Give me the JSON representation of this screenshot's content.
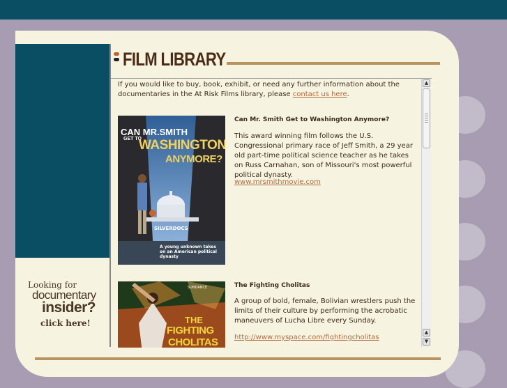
{
  "colors": {
    "brand_teal": "#0a4e63",
    "accent_brown": "#b89460",
    "link": "#b06b3a",
    "text": "#3b2a1b"
  },
  "header": {
    "title": "FILM LIBRARY"
  },
  "sidebar": {
    "promo": {
      "line1": "Looking for",
      "line2": "documentary",
      "line3": "insider?",
      "line4": "click here!"
    }
  },
  "intro": {
    "text_before": "If you would like to buy, book, exhibit, or need any further information about the documentaries in the At Risk Films library, please ",
    "link_text": "contact us here",
    "text_after": "."
  },
  "films": [
    {
      "title": "Can Mr. Smith Get to Washington Anymore?",
      "description": "This award winning film follows the U.S. Congressional primary race of Jeff Smith, a 29 year old part-time political science teacher as he takes on Russ Carnahan, son of Missouri's most powerful political dynasty.",
      "link": "www.mrsmithmovie.com",
      "poster": {
        "line1": "CAN MR.SMITH",
        "line2": "GET TO",
        "line3": "WASHINGTON",
        "line4": "ANYMORE?",
        "award": "SILVERDOCS",
        "tagline": "A young unknown takes on an American political dynasty"
      }
    },
    {
      "title": "The Fighting Cholitas",
      "description": "A group of bold, female, Bolivian wrestlers push the limits of their culture by performing the acrobatic maneuvers of Lucha Libre every Sunday.",
      "link": "http://www.myspace.com/fightingcholitas",
      "poster": {
        "line1": "THE",
        "line2": "FIGHTING",
        "line3": "CHOLITAS",
        "festival": "SUNDANCE"
      }
    }
  ],
  "scrollbar": {
    "up_icon": "arrow-up-icon",
    "down_icon": "arrow-down-icon"
  }
}
